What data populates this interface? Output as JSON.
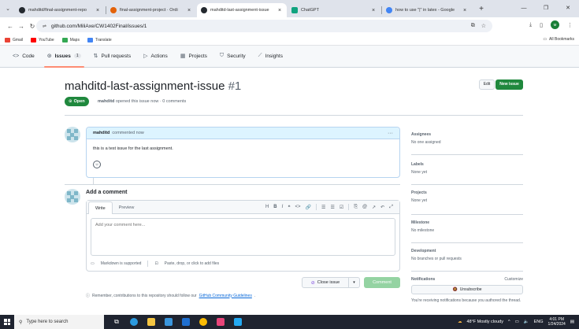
{
  "browser": {
    "tabs": [
      {
        "title": "mahditd/final-assignment-repo",
        "active": false,
        "color": "#24292f"
      },
      {
        "title": "final-assignment-project · Ordi",
        "active": false,
        "color": "#e36209"
      },
      {
        "title": "mahditd-last-assignment-issue",
        "active": true,
        "color": "#24292f"
      },
      {
        "title": "ChatGPT",
        "active": false,
        "color": "#10a37f"
      },
      {
        "title": "how to use \"|\" in latex - Google",
        "active": false,
        "color": "#4285f4"
      }
    ],
    "url": "github.com/MiliAxe/CW1402Final/issues/1",
    "profile_initials": "M",
    "bookmarks": [
      {
        "label": "Gmail",
        "color": "#ea4335"
      },
      {
        "label": "YouTube",
        "color": "#ff0000"
      },
      {
        "label": "Maps",
        "color": "#34a853"
      },
      {
        "label": "Translate",
        "color": "#4285f4"
      }
    ],
    "all_bookmarks": "All Bookmarks"
  },
  "repo_nav": {
    "tabs": [
      {
        "icon": "<>",
        "label": "Code",
        "count": ""
      },
      {
        "icon": "⊙",
        "label": "Issues",
        "count": "1"
      },
      {
        "icon": "⇅",
        "label": "Pull requests",
        "count": ""
      },
      {
        "icon": "▷",
        "label": "Actions",
        "count": ""
      },
      {
        "icon": "▦",
        "label": "Projects",
        "count": ""
      },
      {
        "icon": "⛉",
        "label": "Security",
        "count": ""
      },
      {
        "icon": "⟋",
        "label": "Insights",
        "count": ""
      }
    ]
  },
  "issue": {
    "title": "mahditd-last-assignment-issue",
    "number": "#1",
    "edit_label": "Edit",
    "new_issue_label": "New issue",
    "state_label": "Open",
    "author": "mahditd",
    "meta_text": "opened this issue now · 0 comments"
  },
  "comment": {
    "author": "mahditd",
    "action": "commented now",
    "more": "···",
    "body": "this is a test issue for the last assignment."
  },
  "add_comment": {
    "title": "Add a comment",
    "write_tab": "Write",
    "preview_tab": "Preview",
    "placeholder": "Add your comment here...",
    "markdown_note": "Markdown is supported",
    "paste_note": "Paste, drop, or click to add files",
    "close_label": "Close issue",
    "comment_label": "Comment",
    "reminder_prefix": "Remember, contributions to this repository should follow our",
    "reminder_link": "GitHub Community Guidelines",
    "reminder_suffix": "."
  },
  "sidebar": {
    "assignees": {
      "heading": "Assignees",
      "value": "No one assigned"
    },
    "labels": {
      "heading": "Labels",
      "value": "None yet"
    },
    "projects": {
      "heading": "Projects",
      "value": "None yet"
    },
    "milestone": {
      "heading": "Milestone",
      "value": "No milestone"
    },
    "development": {
      "heading": "Development",
      "value": "No branches or pull requests"
    },
    "notifications": {
      "heading": "Notifications",
      "customize": "Customize",
      "unsubscribe": "Unsubscribe",
      "note": "You're receiving notifications because you authored the thread."
    }
  },
  "taskbar": {
    "search_placeholder": "Type here to search",
    "weather": "48°F  Mostly cloudy",
    "lang": "ENG",
    "time": "4:01 PM",
    "date": "1/24/2024"
  }
}
